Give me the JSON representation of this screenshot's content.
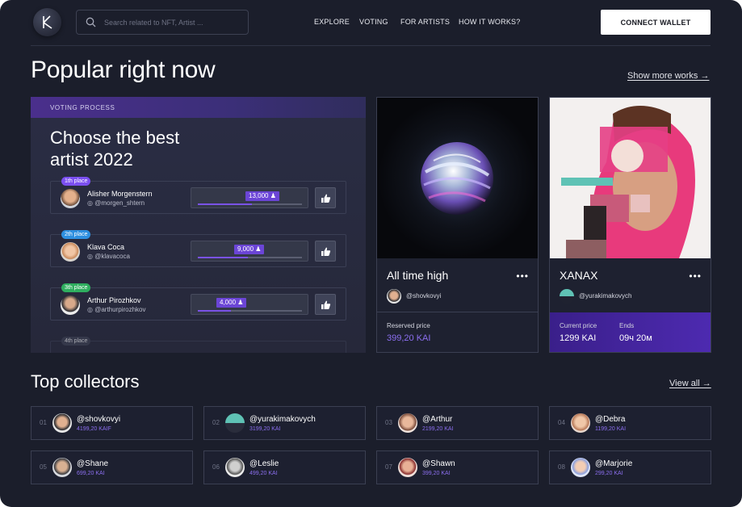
{
  "header": {
    "search_placeholder": "Search related to NFT, Artist ...",
    "nav": [
      "EXPLORE",
      "VOTING",
      "FOR ARTISTS",
      "HOW IT WORKS?"
    ],
    "connect_label": "CONNECT WALLET"
  },
  "popular": {
    "title": "Popular right now",
    "show_more": "Show more works →"
  },
  "voting": {
    "section_label": "VOTING PROCESS",
    "title_line1": "Choose the best",
    "title_line2": "artist 2022",
    "rows": [
      {
        "place": "1th place",
        "name": "Alisher Morgenstern",
        "handle": "@morgen_shtern",
        "votes": "13,000",
        "progress": 0.52,
        "place_color": "#7b4ff0"
      },
      {
        "place": "2th place",
        "name": "Klava Coca",
        "handle": "@klavacoca",
        "votes": "9,000",
        "progress": 0.48,
        "place_color": "#2e8fe0"
      },
      {
        "place": "3th place",
        "name": "Arthur Pirozhkov",
        "handle": "@arthurpirozhkov",
        "votes": "4,000",
        "progress": 0.32,
        "place_color": "#2fae5f"
      },
      {
        "place": "4th place",
        "name": "",
        "handle": "",
        "votes": "",
        "progress": 0,
        "place_color": "#3f4356"
      }
    ]
  },
  "cards": [
    {
      "title": "All time high",
      "handle": "@shovkovyi",
      "label1": "Reserved price",
      "value1": "399,20 KAI"
    },
    {
      "title": "XANAX",
      "handle": "@yurakimakovych",
      "label1": "Current price",
      "value1": "1299 KAI",
      "label2": "Ends",
      "value2": "09ч 20м"
    }
  ],
  "collectors": {
    "title": "Top collectors",
    "view_all": "View all →",
    "items": [
      {
        "num": "01",
        "name": "@shovkovyi",
        "amount": "4199,20 KAIF"
      },
      {
        "num": "02",
        "name": "@yurakimakovych",
        "amount": "3199,20 KAI"
      },
      {
        "num": "03",
        "name": "@Arthur",
        "amount": "2199,20 KAI"
      },
      {
        "num": "04",
        "name": "@Debra",
        "amount": "1199,20 KAI"
      },
      {
        "num": "05",
        "name": "@Shane",
        "amount": "699,20 KAI"
      },
      {
        "num": "06",
        "name": "@Leslie",
        "amount": "499,20 KAI"
      },
      {
        "num": "07",
        "name": "@Shawn",
        "amount": "399,20 KAI"
      },
      {
        "num": "08",
        "name": "@Marjorie",
        "amount": "299,20 KAI"
      }
    ]
  },
  "colors": {
    "accent": "#6b45d6",
    "bg": "#1b1e2b"
  }
}
